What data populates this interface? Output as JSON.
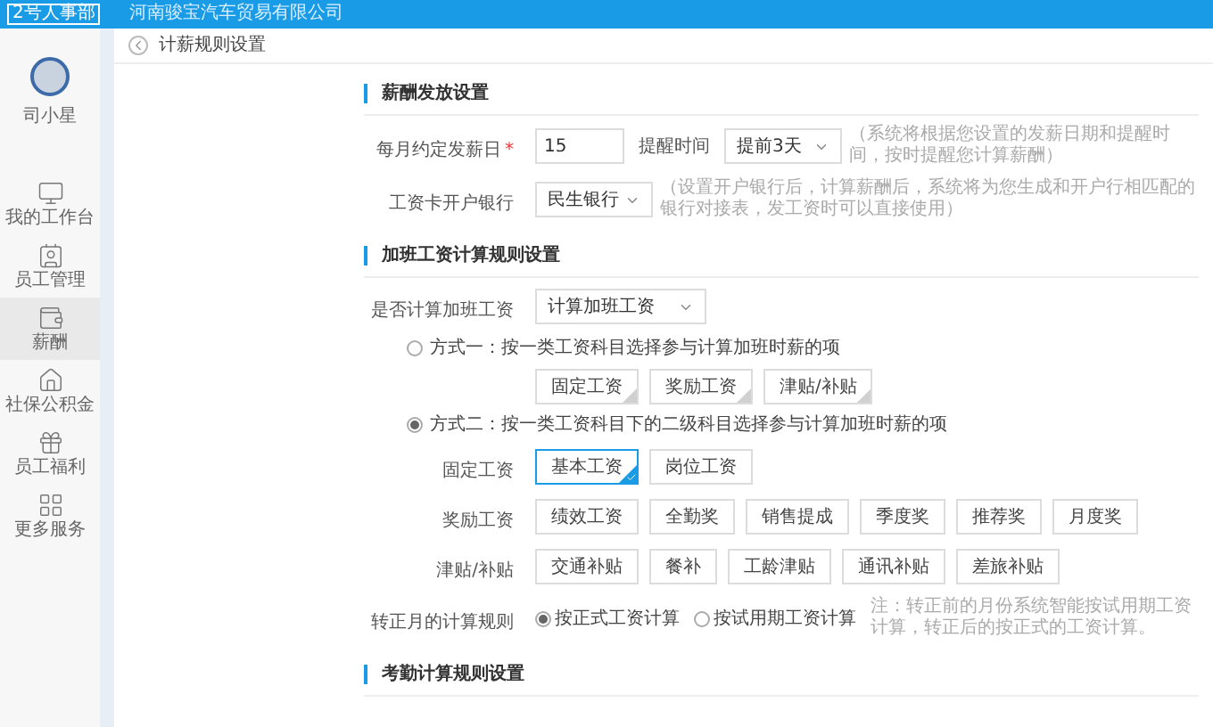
{
  "topbar": {
    "logo": "2号人事部",
    "company": "河南骏宝汽车贸易有限公司"
  },
  "sidebar": {
    "user": "司小星",
    "items": [
      {
        "label": "我的工作台",
        "kind": "monitor",
        "selected": false
      },
      {
        "label": "员工管理",
        "kind": "staff",
        "selected": false
      },
      {
        "label": "薪酬",
        "kind": "wallet",
        "selected": true
      },
      {
        "label": "社保公积金",
        "kind": "house",
        "selected": false
      },
      {
        "label": "员工福利",
        "kind": "gift",
        "selected": false
      },
      {
        "label": "更多服务",
        "kind": "grid",
        "selected": false
      }
    ]
  },
  "page_title": "计薪规则设置",
  "salary_payment": {
    "title": "薪酬发放设置",
    "payday": {
      "label": "每月约定发薪日",
      "required_mark": "*",
      "value": "15"
    },
    "reminder": {
      "label": "提醒时间",
      "value": "提前3天",
      "hint": "（系统将根据您设置的发薪日期和提醒时间，按时提醒您计算薪酬）"
    },
    "bank": {
      "label": "工资卡开户银行",
      "value": "民生银行",
      "hint": "（设置开户银行后，计算薪酬后，系统将为您生成和开户行相匹配的银行对接表，发工资时可以直接使用）"
    }
  },
  "overtime": {
    "title": "加班工资计算规则设置",
    "calc": {
      "label": "是否计算加班工资",
      "value": "计算加班工资"
    },
    "methods": [
      {
        "label": "方式一：按一类工资科目选择参与计算加班时薪的项",
        "selected": false,
        "groups": [
          {
            "items": [
              {
                "label": "固定工资",
                "checked": false
              },
              {
                "label": "奖励工资",
                "checked": false
              },
              {
                "label": "津贴/补贴",
                "checked": false
              }
            ]
          }
        ]
      },
      {
        "label": "方式二：按一类工资科目下的二级科目选择参与计算加班时薪的项",
        "selected": true,
        "groups": [
          {
            "label": "固定工资",
            "items": [
              {
                "label": "基本工资",
                "checked": true
              },
              {
                "label": "岗位工资",
                "checked": false
              }
            ]
          },
          {
            "label": "奖励工资",
            "items": [
              {
                "label": "绩效工资",
                "checked": false
              },
              {
                "label": "全勤奖",
                "checked": false
              },
              {
                "label": "销售提成",
                "checked": false
              },
              {
                "label": "季度奖",
                "checked": false
              },
              {
                "label": "推荐奖",
                "checked": false
              },
              {
                "label": "月度奖",
                "checked": false
              }
            ]
          },
          {
            "label": "津贴/补贴",
            "items": [
              {
                "label": "交通补贴",
                "checked": false
              },
              {
                "label": "餐补",
                "checked": false
              },
              {
                "label": "工龄津贴",
                "checked": false
              },
              {
                "label": "通讯补贴",
                "checked": false
              },
              {
                "label": "差旅补贴",
                "checked": false
              }
            ]
          }
        ]
      }
    ],
    "regularization": {
      "label": "转正月的计算规则",
      "options": [
        {
          "label": "按正式工资计算",
          "selected": true
        },
        {
          "label": "按试用期工资计算",
          "selected": false
        }
      ],
      "note": "注：转正前的月份系统智能按试用期工资计算，转正后的按正式的工资计算。"
    }
  },
  "attendance": {
    "title": "考勤计算规则设置"
  }
}
